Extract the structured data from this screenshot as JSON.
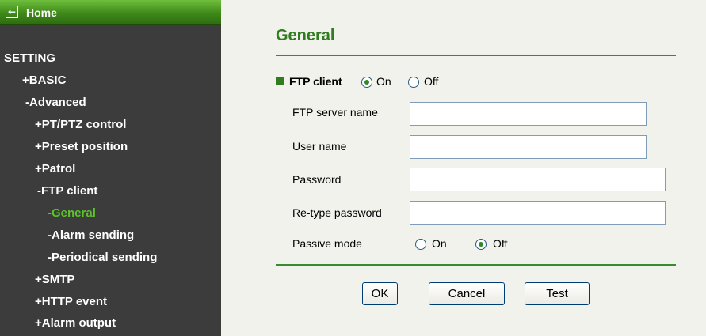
{
  "sidebar": {
    "home_icon": "back-arrow-icon",
    "home_label": "Home",
    "items": [
      {
        "label": "SETTING",
        "active": false
      },
      {
        "label": "+BASIC",
        "active": false
      },
      {
        "label": "-Advanced",
        "active": false
      },
      {
        "label": "+PT/PTZ control",
        "active": false
      },
      {
        "label": "+Preset position",
        "active": false
      },
      {
        "label": "+Patrol",
        "active": false
      },
      {
        "label": "-FTP client",
        "active": false
      },
      {
        "label": "-General",
        "active": true
      },
      {
        "label": "-Alarm sending",
        "active": false
      },
      {
        "label": "-Periodical sending",
        "active": false
      },
      {
        "label": "+SMTP",
        "active": false
      },
      {
        "label": "+HTTP event",
        "active": false
      },
      {
        "label": "+Alarm output",
        "active": false
      }
    ]
  },
  "main": {
    "title": "General",
    "ftp_client": {
      "label": "FTP client",
      "on_label": "On",
      "off_label": "Off",
      "selected": "On"
    },
    "fields": {
      "server_name": {
        "label": "FTP server name",
        "value": ""
      },
      "user_name": {
        "label": "User name",
        "value": ""
      },
      "password": {
        "label": "Password",
        "value": ""
      },
      "retype_password": {
        "label": "Re-type password",
        "value": ""
      }
    },
    "passive_mode": {
      "label": "Passive mode",
      "on_label": "On",
      "off_label": "Off",
      "selected": "Off"
    },
    "buttons": {
      "ok": "OK",
      "cancel": "Cancel",
      "test": "Test"
    }
  },
  "colors": {
    "sidebar_bg": "#3c3c3c",
    "accent_green": "#2f7d1f",
    "active_item": "#5cc22a",
    "content_bg": "#f2f2ec"
  }
}
